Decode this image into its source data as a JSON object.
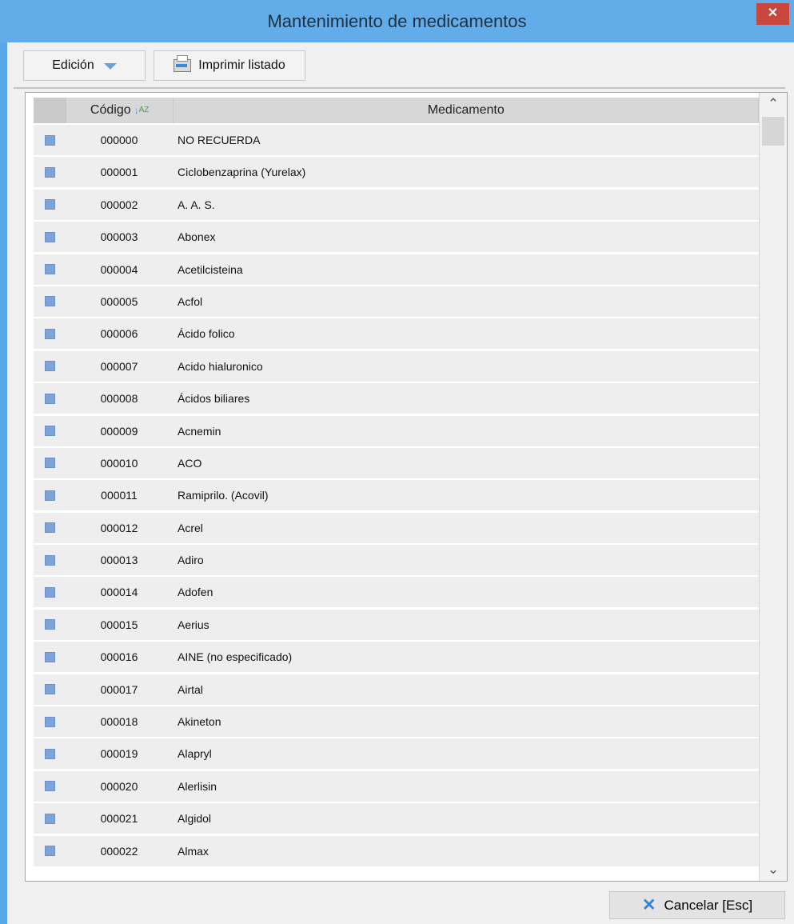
{
  "window": {
    "title": "Mantenimiento de medicamentos",
    "close_icon": "✕"
  },
  "toolbar": {
    "edicion_label": "Edición",
    "imprimir_label": "Imprimir listado"
  },
  "table": {
    "headers": [
      "",
      "Código",
      "Medicamento"
    ],
    "rows": [
      [
        "000000",
        "NO RECUERDA"
      ],
      [
        "000001",
        "Ciclobenzaprina (Yurelax)"
      ],
      [
        "000002",
        "A. A. S."
      ],
      [
        "000003",
        "Abonex"
      ],
      [
        "000004",
        "Acetilcisteina"
      ],
      [
        "000005",
        "Acfol"
      ],
      [
        "000006",
        "Ácido folico"
      ],
      [
        "000007",
        "Acido hialuronico"
      ],
      [
        "000008",
        "Ácidos biliares"
      ],
      [
        "000009",
        "Acnemin"
      ],
      [
        "000010",
        "ACO"
      ],
      [
        "000011",
        "Ramiprilo. (Acovil)"
      ],
      [
        "000012",
        "Acrel"
      ],
      [
        "000013",
        "Adiro"
      ],
      [
        "000014",
        "Adofen"
      ],
      [
        "000015",
        "Aerius"
      ],
      [
        "000016",
        "AINE (no especificado)"
      ],
      [
        "000017",
        "Airtal"
      ],
      [
        "000018",
        "Akineton"
      ],
      [
        "000019",
        "Alapryl"
      ],
      [
        "000020",
        "Alerlisin"
      ],
      [
        "000021",
        "Algidol"
      ],
      [
        "000022",
        "Almax"
      ]
    ]
  },
  "footer": {
    "cancel_label": "Cancelar  [Esc]"
  },
  "colors": {
    "title_bar": "#62acea",
    "close": "#c9463d",
    "marker": "#7ea3d8"
  }
}
